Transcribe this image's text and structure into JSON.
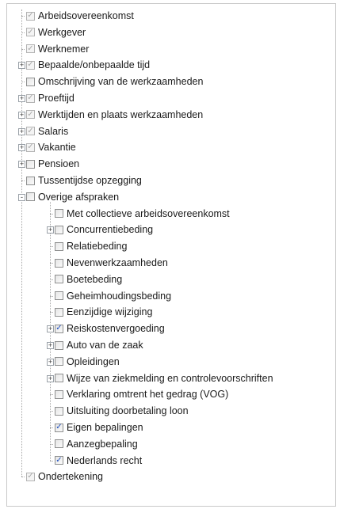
{
  "tree": {
    "items": [
      {
        "label": "Arbeidsovereenkomst",
        "check": "gray",
        "level": 0,
        "expander": ""
      },
      {
        "label": "Werkgever",
        "check": "gray",
        "level": 0,
        "expander": ""
      },
      {
        "label": "Werknemer",
        "check": "gray",
        "level": 0,
        "expander": ""
      },
      {
        "label": "Bepaalde/onbepaalde tijd",
        "check": "gray",
        "level": 0,
        "expander": "+"
      },
      {
        "label": "Omschrijving van de werkzaamheden",
        "check": "empty",
        "level": 0,
        "expander": ""
      },
      {
        "label": "Proeftijd",
        "check": "gray",
        "level": 0,
        "expander": "+"
      },
      {
        "label": "Werktijden en plaats werkzaamheden",
        "check": "gray",
        "level": 0,
        "expander": "+"
      },
      {
        "label": "Salaris",
        "check": "gray",
        "level": 0,
        "expander": "+"
      },
      {
        "label": "Vakantie",
        "check": "gray",
        "level": 0,
        "expander": "+"
      },
      {
        "label": "Pensioen",
        "check": "empty",
        "level": 0,
        "expander": "+"
      },
      {
        "label": "Tussentijdse opzegging",
        "check": "empty",
        "level": 0,
        "expander": ""
      },
      {
        "label": "Overige afspraken",
        "check": "empty",
        "level": 0,
        "expander": "-"
      },
      {
        "label": "Met collectieve arbeidsovereenkomst",
        "check": "empty",
        "level": 1,
        "expander": ""
      },
      {
        "label": "Concurrentiebeding",
        "check": "empty",
        "level": 1,
        "expander": "+"
      },
      {
        "label": "Relatiebeding",
        "check": "empty",
        "level": 1,
        "expander": ""
      },
      {
        "label": "Nevenwerkzaamheden",
        "check": "empty",
        "level": 1,
        "expander": ""
      },
      {
        "label": "Boetebeding",
        "check": "empty",
        "level": 1,
        "expander": ""
      },
      {
        "label": "Geheimhoudingsbeding",
        "check": "empty",
        "level": 1,
        "expander": ""
      },
      {
        "label": "Eenzijdige wijziging",
        "check": "empty",
        "level": 1,
        "expander": ""
      },
      {
        "label": "Reiskostenvergoeding",
        "check": "blue",
        "level": 1,
        "expander": "+"
      },
      {
        "label": "Auto van de zaak",
        "check": "empty",
        "level": 1,
        "expander": "+"
      },
      {
        "label": "Opleidingen",
        "check": "empty",
        "level": 1,
        "expander": "+"
      },
      {
        "label": "Wijze van ziekmelding en controlevoorschriften",
        "check": "empty",
        "level": 1,
        "expander": "+"
      },
      {
        "label": "Verklaring omtrent het gedrag (VOG)",
        "check": "empty",
        "level": 1,
        "expander": ""
      },
      {
        "label": "Uitsluiting doorbetaling loon",
        "check": "empty",
        "level": 1,
        "expander": ""
      },
      {
        "label": "Eigen bepalingen",
        "check": "blue",
        "level": 1,
        "expander": ""
      },
      {
        "label": "Aanzegbepaling",
        "check": "empty",
        "level": 1,
        "expander": ""
      },
      {
        "label": "Nederlands recht",
        "check": "blue",
        "level": 1,
        "expander": ""
      },
      {
        "label": "Ondertekening",
        "check": "gray",
        "level": 0,
        "expander": ""
      }
    ],
    "check_glyph": "✓",
    "colors": {
      "checked_blue": "#1e4fbf",
      "checked_gray": "#a8a8a8",
      "connector": "#a8a8a8"
    }
  }
}
